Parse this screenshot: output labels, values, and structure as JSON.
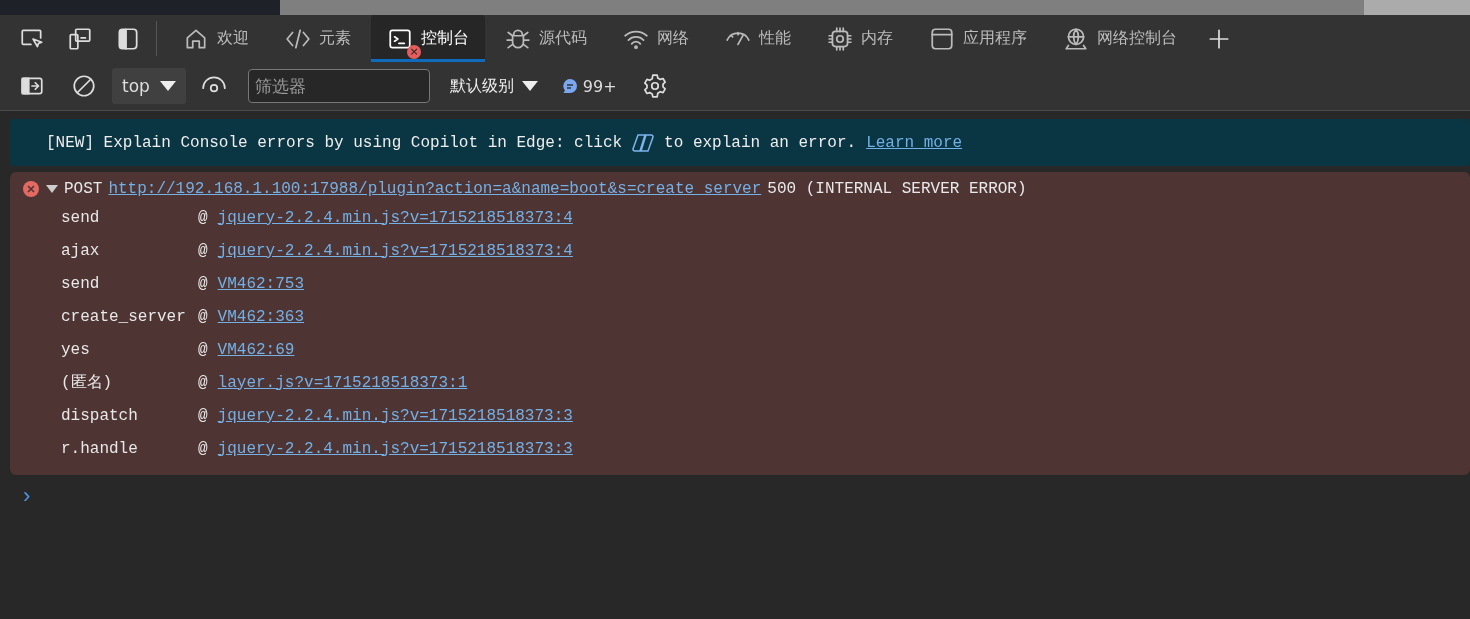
{
  "tabs": [
    {
      "kind": "home",
      "label": "欢迎",
      "selected": false
    },
    {
      "kind": "code",
      "label": "元素",
      "selected": false
    },
    {
      "kind": "console",
      "label": "控制台",
      "selected": true,
      "error_badge": "×"
    },
    {
      "kind": "bug",
      "label": "源代码",
      "selected": false
    },
    {
      "kind": "wifi",
      "label": "网络",
      "selected": false
    },
    {
      "kind": "gauge",
      "label": "性能",
      "selected": false
    },
    {
      "kind": "chip",
      "label": "内存",
      "selected": false
    },
    {
      "kind": "window",
      "label": "应用程序",
      "selected": false
    },
    {
      "kind": "globe",
      "label": "网络控制台",
      "selected": false
    }
  ],
  "toolbar": {
    "context": "top",
    "filter_placeholder": "筛选器",
    "level": "默认级别",
    "message_count": "99+"
  },
  "banner": {
    "before": "[NEW] Explain Console errors by using Copilot in Edge: click",
    "after": "to explain an error.",
    "link": "Learn more"
  },
  "error": {
    "method": "POST",
    "url": "http://192.168.1.100:17988/plugin?action=a&name=boot&s=create_server",
    "status": "500 (INTERNAL SERVER ERROR)",
    "expanded": true,
    "frames": [
      {
        "name": "send",
        "at": "@",
        "location": "jquery-2.2.4.min.js?v=1715218518373:4"
      },
      {
        "name": "ajax",
        "at": "@",
        "location": "jquery-2.2.4.min.js?v=1715218518373:4"
      },
      {
        "name": "send",
        "at": "@",
        "location": "VM462:753"
      },
      {
        "name": "create_server",
        "at": "@",
        "location": "VM462:363"
      },
      {
        "name": "yes",
        "at": "@",
        "location": "VM462:69"
      },
      {
        "name": "(匿名)",
        "at": "@",
        "location": "layer.js?v=1715218518373:1"
      },
      {
        "name": "dispatch",
        "at": "@",
        "location": "jquery-2.2.4.min.js?v=1715218518373:3"
      },
      {
        "name": "r.handle",
        "at": "@",
        "location": "jquery-2.2.4.min.js?v=1715218518373:3"
      }
    ]
  },
  "prompt": "›"
}
